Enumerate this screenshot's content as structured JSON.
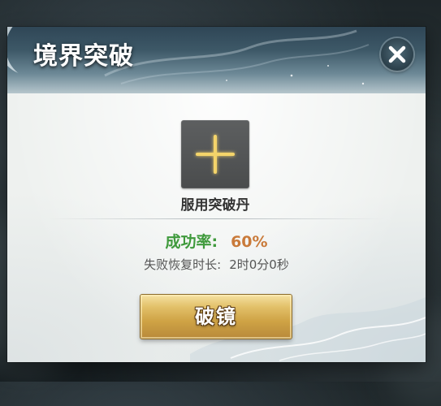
{
  "dialog": {
    "title": "境界突破",
    "close_icon": "close-icon"
  },
  "item_slot": {
    "icon": "plus-icon",
    "label": "服用突破丹"
  },
  "stats": {
    "success_rate_label": "成功率:",
    "success_rate_value": "60%",
    "recovery_label": "失败恢复时长:",
    "recovery_value": "2时0分0秒"
  },
  "actions": {
    "breakthrough_label": "破镜"
  },
  "colors": {
    "success_label": "#3f9a3c",
    "success_value": "#c97a3a",
    "button_gold": "#cfa345",
    "plus_glow": "#f4d46a"
  }
}
